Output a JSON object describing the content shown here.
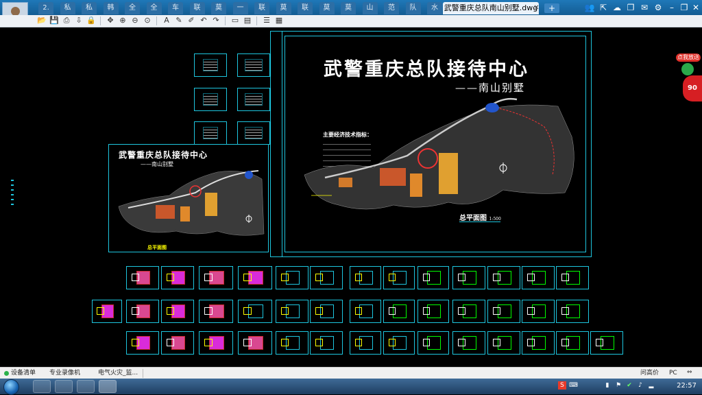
{
  "titlebar": {
    "tabs": [
      "2.",
      "私",
      "私",
      "韩",
      "全",
      "全",
      "车",
      "联",
      "莫",
      "一",
      "联",
      "莫",
      "联",
      "莫",
      "莫",
      "山",
      "范",
      "队",
      "水"
    ],
    "active_tab": "武警重庆总队南山别墅.dwg",
    "new_tab": "+"
  },
  "drawing": {
    "main_title": "武警重庆总队接待中心",
    "subtitle": "——南山别墅",
    "tech_title": "主要经济技术指标：",
    "plan_label": "总平面图",
    "plan_scale": "1:500",
    "small_title": "武警重庆总队接待中心",
    "small_subtitle": "——南山别墅",
    "small_plan_label": "总平面图"
  },
  "badges": {
    "grade": "点我放送",
    "number": "90"
  },
  "statusbar": {
    "items": [
      "设备清单",
      "专业录像机",
      "电气火灾_监..."
    ],
    "right": "问高价",
    "input_label": "PC"
  },
  "taskbar": {
    "time": "22:57"
  },
  "colors": {
    "frame": "#1ec7e0",
    "accent_red": "#d61f23",
    "title_bar": "#1f78b8"
  }
}
